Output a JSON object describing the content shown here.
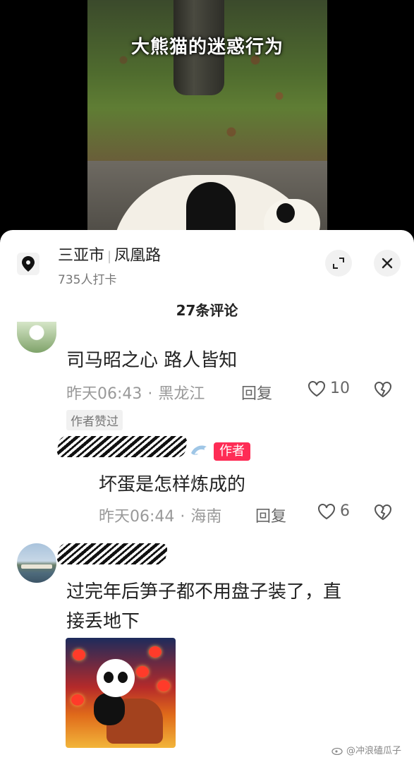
{
  "video": {
    "title": "大熊猫的迷惑行为"
  },
  "location": {
    "city": "三亚市",
    "road": "凤凰路",
    "checkins": "735人打卡"
  },
  "comments_header": {
    "count_label": "27条评论"
  },
  "comments": [
    {
      "text": "司马昭之心 路人皆知",
      "time": "昨天06:43",
      "region": "黑龙江",
      "reply_label": "回复",
      "likes": "10",
      "tag": "作者赞过"
    },
    {
      "text": "坏蛋是怎样炼成的",
      "time": "昨天06:44",
      "region": "海南",
      "reply_label": "回复",
      "likes": "6",
      "badge": "作者"
    },
    {
      "text": "过完年后笋子都不用盘子装了，直接丢地下",
      "text_line1": "过完年后笋子都不用盘子装了，直",
      "text_line2": "接丢地下"
    }
  ],
  "watermark": {
    "text": "@冲浪磕瓜子"
  },
  "colors": {
    "accent": "#fe2c55",
    "sheet_bg": "#ffffff",
    "meta_text": "#999999"
  },
  "icons": [
    "location-pin-icon",
    "expand-icon",
    "close-icon",
    "heart-icon",
    "dislike-heart-icon",
    "dolphin-icon",
    "weibo-icon"
  ]
}
